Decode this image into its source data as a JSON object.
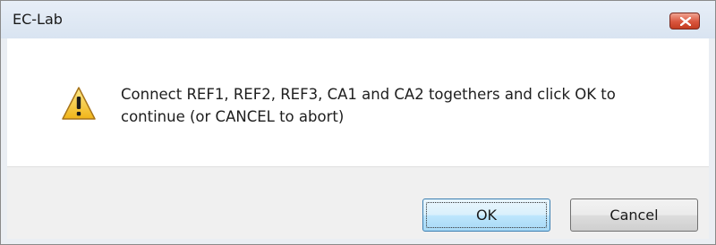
{
  "window": {
    "title": "EC-Lab",
    "close_icon": "close-icon"
  },
  "dialog": {
    "icon": "warning-icon",
    "message_line1": "Connect REF1, REF2, REF3, CA1 and CA2 togethers and click OK to",
    "message_line2": "continue (or CANCEL to abort)"
  },
  "buttons": {
    "ok_label": "OK",
    "cancel_label": "Cancel"
  },
  "colors": {
    "titlebar": "#dfe8f3",
    "close_button": "#d9553d",
    "footer": "#f0f0f0",
    "warning_fill": "#f5c838"
  }
}
